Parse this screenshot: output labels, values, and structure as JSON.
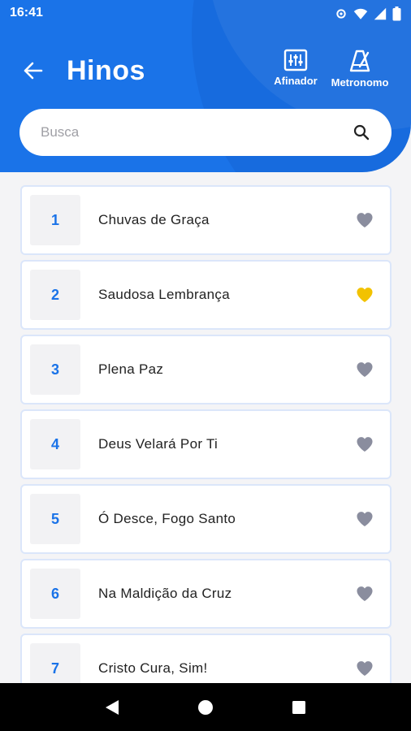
{
  "status": {
    "time": "16:41",
    "icons": [
      "settings-icon",
      "wifi-icon",
      "signal-icon",
      "battery-icon"
    ]
  },
  "header": {
    "title": "Hinos",
    "back_icon": "arrow-left-icon",
    "tools": [
      {
        "label": "Afinador",
        "icon": "tuner-icon"
      },
      {
        "label": "Metronomo",
        "icon": "metronome-icon"
      }
    ]
  },
  "search": {
    "placeholder": "Busca",
    "value": "",
    "icon": "search-icon"
  },
  "hymns": [
    {
      "number": "1",
      "title": "Chuvas de Graça",
      "favorite": false
    },
    {
      "number": "2",
      "title": "Saudosa Lembrança",
      "favorite": true
    },
    {
      "number": "3",
      "title": "Plena Paz",
      "favorite": false
    },
    {
      "number": "4",
      "title": "Deus Velará Por Ti",
      "favorite": false
    },
    {
      "number": "5",
      "title": "Ó Desce, Fogo Santo",
      "favorite": false
    },
    {
      "number": "6",
      "title": "Na Maldição da Cruz",
      "favorite": false
    },
    {
      "number": "7",
      "title": "Cristo Cura, Sim!",
      "favorite": false
    }
  ],
  "colors": {
    "primary": "#1a73e8",
    "favorite_on": "#f2c200",
    "favorite_off": "#8a8d9e",
    "number": "#1a73e8"
  },
  "nav": [
    "back-icon",
    "home-icon",
    "recents-icon"
  ]
}
